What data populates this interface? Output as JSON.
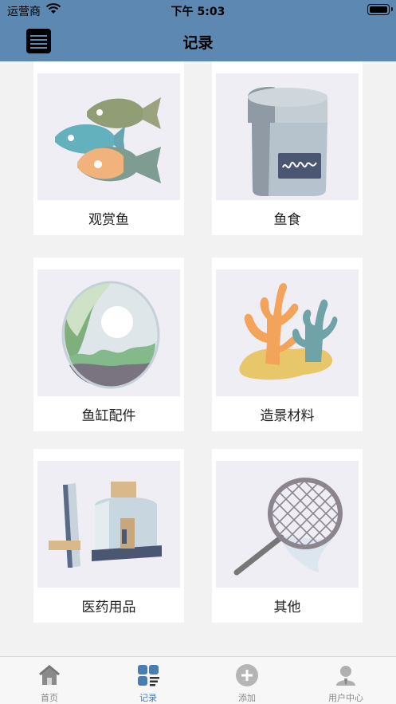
{
  "status_bar": {
    "carrier": "运营商",
    "time": "下午 5:03"
  },
  "nav": {
    "title": "记录"
  },
  "cards": [
    {
      "label": "观赏鱼",
      "icon": "fish-icon"
    },
    {
      "label": "鱼食",
      "icon": "fish-food-icon"
    },
    {
      "label": "鱼缸配件",
      "icon": "aquarium-decoration-icon"
    },
    {
      "label": "造景材料",
      "icon": "coral-icon"
    },
    {
      "label": "医药用品",
      "icon": "aquarium-equipment-icon"
    },
    {
      "label": "其他",
      "icon": "fish-net-icon"
    }
  ],
  "tabbar": {
    "items": [
      {
        "label": "首页",
        "icon": "home-icon",
        "active": false
      },
      {
        "label": "记录",
        "icon": "records-icon",
        "active": true
      },
      {
        "label": "添加",
        "icon": "add-icon",
        "active": false
      },
      {
        "label": "用户中心",
        "icon": "user-icon",
        "active": false
      }
    ]
  },
  "colors": {
    "header": "#5d88b2",
    "active_tab": "#4a7eb3",
    "inactive_tab": "#888888",
    "background": "#f2f2f2"
  }
}
